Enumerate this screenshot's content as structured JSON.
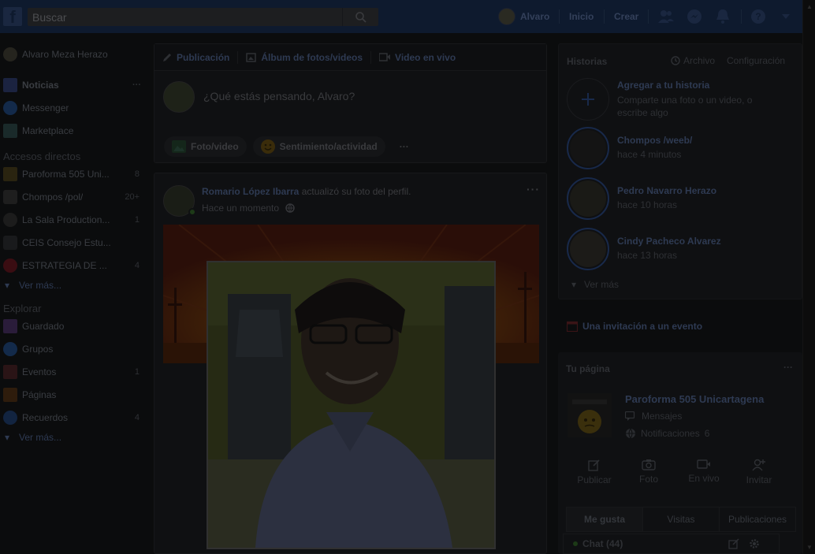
{
  "topbar": {
    "logo": "f",
    "search_placeholder": "Buscar",
    "user_name": "Alvaro",
    "links": [
      "Inicio",
      "Crear"
    ],
    "icons": [
      "friends-icon",
      "messenger-icon",
      "bell-icon",
      "help-icon",
      "caret-down-icon"
    ]
  },
  "left_nav": {
    "profile": "Alvaro Meza Herazo",
    "main": [
      {
        "label": "Noticias",
        "icon": "news-icon",
        "color": "#1b2340"
      },
      {
        "label": "Messenger",
        "icon": "messenger-icon",
        "color": "#132a4a"
      },
      {
        "label": "Marketplace",
        "icon": "shop-icon",
        "color": "#1a2a2a"
      }
    ],
    "news_more": "···",
    "shortcuts_title": "Accesos directos",
    "shortcuts": [
      {
        "label": "Paroforma 505 Uni...",
        "count": "8"
      },
      {
        "label": "Chompos /pol/",
        "count": "20+"
      },
      {
        "label": "La Sala Production...",
        "count": "1"
      },
      {
        "label": "CEIS Consejo Estu...",
        "count": ""
      },
      {
        "label": "ESTRATEGIA DE ...",
        "count": "4"
      }
    ],
    "see_more": "Ver más...",
    "explore_title": "Explorar",
    "explore": [
      {
        "label": "Guardado",
        "count": ""
      },
      {
        "label": "Grupos",
        "count": ""
      },
      {
        "label": "Eventos",
        "count": "1"
      },
      {
        "label": "Páginas",
        "count": ""
      },
      {
        "label": "Recuerdos",
        "count": "4"
      }
    ],
    "see_more2": "Ver más..."
  },
  "composer": {
    "tabs": [
      "Publicación",
      "Álbum de fotos/videos",
      "Video en vivo"
    ],
    "placeholder": "¿Qué estás pensando, Alvaro?",
    "actions": [
      "Foto/video",
      "Sentimiento/actividad",
      "···"
    ]
  },
  "post": {
    "author": "Romario López Ibarra",
    "action": " actualizó su foto del perfil.",
    "time": "Hace un momento",
    "more": "···"
  },
  "stories": {
    "title": "Historias",
    "archive": "Archivo",
    "settings": "Configuración",
    "add_title": "Agregar a tu historia",
    "add_sub": "Comparte una foto o un video, o escribe algo",
    "items": [
      {
        "name": "Chompos /weeb/",
        "time": "hace 4 minutos"
      },
      {
        "name": "Pedro Navarro Herazo",
        "time": "hace 10 horas"
      },
      {
        "name": "Cindy Pacheco Alvarez",
        "time": "hace 13 horas"
      }
    ],
    "see_more": "Ver más"
  },
  "event_invite": "Una invitación a un evento",
  "your_page": {
    "title": "Tu página",
    "more": "···",
    "name": "Paroforma 505 Unicartagena",
    "messages": "Mensajes",
    "notifications": "Notificaciones",
    "notifications_count": "6",
    "actions": [
      "Publicar",
      "Foto",
      "En vivo",
      "Invitar"
    ],
    "tabs": [
      "Me gusta",
      "Visitas",
      "Publicaciones"
    ]
  },
  "chat": {
    "label": "Chat (44)"
  }
}
